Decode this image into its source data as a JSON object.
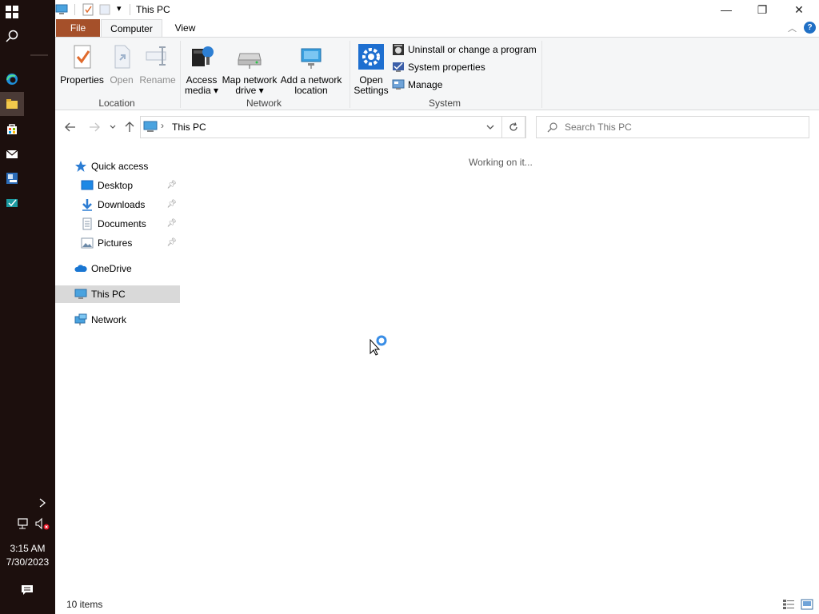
{
  "taskbar": {
    "time": "3:15 AM",
    "date": "7/30/2023"
  },
  "window": {
    "title": "This PC",
    "controls": {
      "minimize": "—",
      "maximize": "❐",
      "close": "✕"
    }
  },
  "ribbon_tabs": [
    "File",
    "Computer",
    "View"
  ],
  "ribbon": {
    "location": {
      "label": "Location",
      "properties": "Properties",
      "open": "Open",
      "rename": "Rename"
    },
    "network": {
      "label": "Network",
      "access_media_1": "Access",
      "access_media_2": "media ▾",
      "map_drive_1": "Map network",
      "map_drive_2": "drive ▾",
      "add_location_1": "Add a network",
      "add_location_2": "location"
    },
    "system": {
      "label": "System",
      "open_settings_1": "Open",
      "open_settings_2": "Settings",
      "uninstall": "Uninstall or change a program",
      "system_properties": "System properties",
      "manage": "Manage"
    }
  },
  "address": {
    "path": "This PC",
    "search_placeholder": "Search This PC"
  },
  "nav_pane": {
    "quick_access": "Quick access",
    "desktop": "Desktop",
    "downloads": "Downloads",
    "documents": "Documents",
    "pictures": "Pictures",
    "onedrive": "OneDrive",
    "this_pc": "This PC",
    "network": "Network"
  },
  "content": {
    "status": "Working on it..."
  },
  "statusbar": {
    "item_count": "10 items"
  },
  "colors": {
    "file_tab": "#a5502a",
    "taskbar": "#1c0f0d",
    "accent": "#0078d7"
  }
}
